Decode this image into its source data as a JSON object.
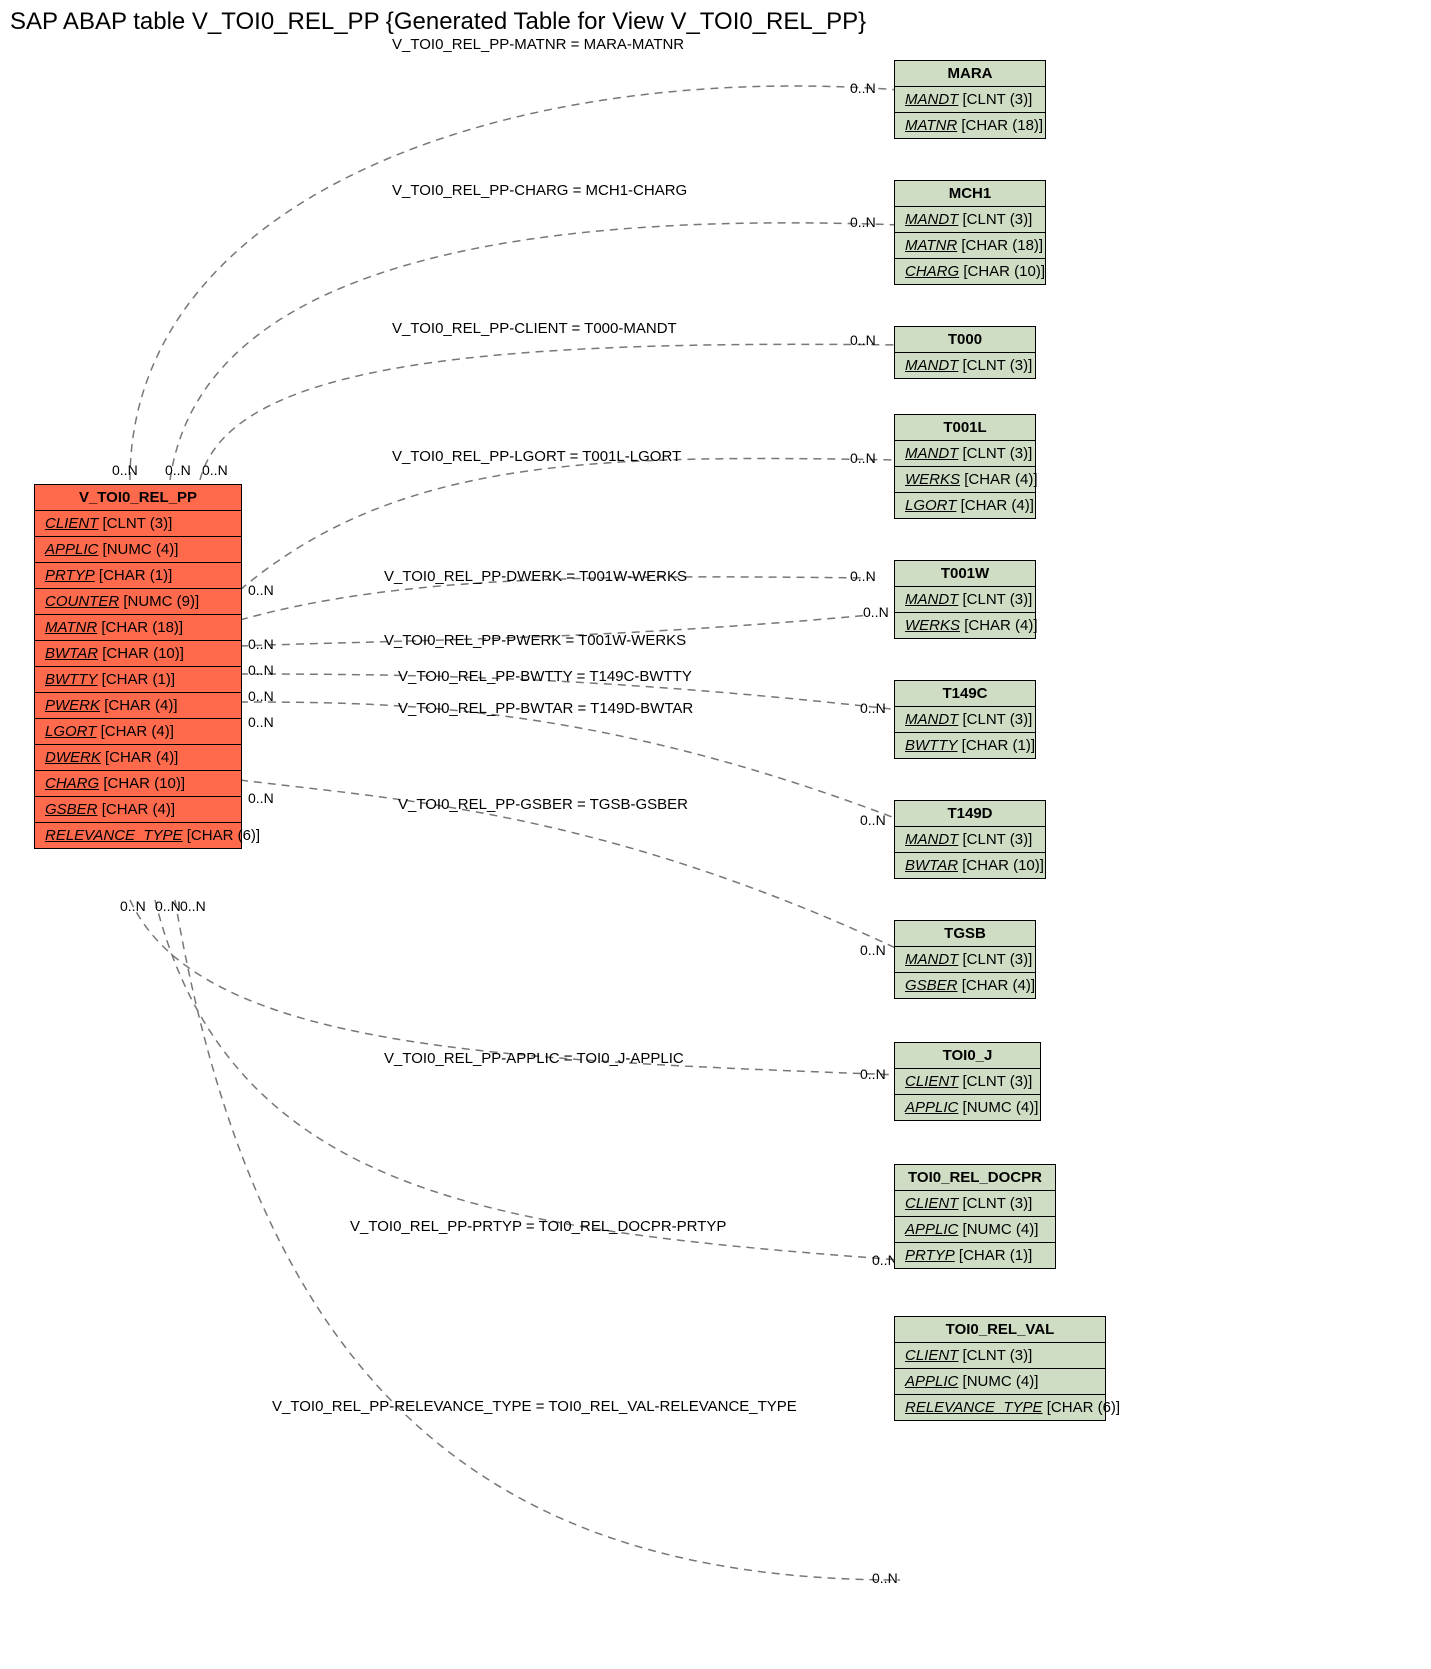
{
  "title": "SAP ABAP table V_TOI0_REL_PP {Generated Table for View V_TOI0_REL_PP}",
  "main_entity": {
    "name": "V_TOI0_REL_PP",
    "fields": [
      {
        "f": "CLIENT",
        "t": "[CLNT (3)]"
      },
      {
        "f": "APPLIC",
        "t": "[NUMC (4)]"
      },
      {
        "f": "PRTYP",
        "t": "[CHAR (1)]"
      },
      {
        "f": "COUNTER",
        "t": "[NUMC (9)]"
      },
      {
        "f": "MATNR",
        "t": "[CHAR (18)]"
      },
      {
        "f": "BWTAR",
        "t": "[CHAR (10)]"
      },
      {
        "f": "BWTTY",
        "t": "[CHAR (1)]"
      },
      {
        "f": "PWERK",
        "t": "[CHAR (4)]"
      },
      {
        "f": "LGORT",
        "t": "[CHAR (4)]"
      },
      {
        "f": "DWERK",
        "t": "[CHAR (4)]"
      },
      {
        "f": "CHARG",
        "t": "[CHAR (10)]"
      },
      {
        "f": "GSBER",
        "t": "[CHAR (4)]"
      },
      {
        "f": "RELEVANCE_TYPE",
        "t": "[CHAR (6)]"
      }
    ]
  },
  "entities": [
    {
      "name": "MARA",
      "fields": [
        {
          "f": "MANDT",
          "t": "[CLNT (3)]"
        },
        {
          "f": "MATNR",
          "t": "[CHAR (18)]"
        }
      ]
    },
    {
      "name": "MCH1",
      "fields": [
        {
          "f": "MANDT",
          "t": "[CLNT (3)]"
        },
        {
          "f": "MATNR",
          "t": "[CHAR (18)]"
        },
        {
          "f": "CHARG",
          "t": "[CHAR (10)]"
        }
      ]
    },
    {
      "name": "T000",
      "fields": [
        {
          "f": "MANDT",
          "t": "[CLNT (3)]"
        }
      ]
    },
    {
      "name": "T001L",
      "fields": [
        {
          "f": "MANDT",
          "t": "[CLNT (3)]"
        },
        {
          "f": "WERKS",
          "t": "[CHAR (4)]"
        },
        {
          "f": "LGORT",
          "t": "[CHAR (4)]"
        }
      ]
    },
    {
      "name": "T001W",
      "fields": [
        {
          "f": "MANDT",
          "t": "[CLNT (3)]"
        },
        {
          "f": "WERKS",
          "t": "[CHAR (4)]"
        }
      ]
    },
    {
      "name": "T149C",
      "fields": [
        {
          "f": "MANDT",
          "t": "[CLNT (3)]"
        },
        {
          "f": "BWTTY",
          "t": "[CHAR (1)]"
        }
      ]
    },
    {
      "name": "T149D",
      "fields": [
        {
          "f": "MANDT",
          "t": "[CLNT (3)]"
        },
        {
          "f": "BWTAR",
          "t": "[CHAR (10)]"
        }
      ]
    },
    {
      "name": "TGSB",
      "fields": [
        {
          "f": "MANDT",
          "t": "[CLNT (3)]"
        },
        {
          "f": "GSBER",
          "t": "[CHAR (4)]"
        }
      ]
    },
    {
      "name": "TOI0_J",
      "fields": [
        {
          "f": "CLIENT",
          "t": "[CLNT (3)]"
        },
        {
          "f": "APPLIC",
          "t": "[NUMC (4)]"
        }
      ]
    },
    {
      "name": "TOI0_REL_DOCPR",
      "fields": [
        {
          "f": "CLIENT",
          "t": "[CLNT (3)]"
        },
        {
          "f": "APPLIC",
          "t": "[NUMC (4)]"
        },
        {
          "f": "PRTYP",
          "t": "[CHAR (1)]"
        }
      ]
    },
    {
      "name": "TOI0_REL_VAL",
      "fields": [
        {
          "f": "CLIENT",
          "t": "[CLNT (3)]"
        },
        {
          "f": "APPLIC",
          "t": "[NUMC (4)]"
        },
        {
          "f": "RELEVANCE_TYPE",
          "t": "[CHAR (6)]"
        }
      ]
    }
  ],
  "relations": [
    {
      "label": "V_TOI0_REL_PP-MATNR = MARA-MATNR"
    },
    {
      "label": "V_TOI0_REL_PP-CHARG = MCH1-CHARG"
    },
    {
      "label": "V_TOI0_REL_PP-CLIENT = T000-MANDT"
    },
    {
      "label": "V_TOI0_REL_PP-LGORT = T001L-LGORT"
    },
    {
      "label": "V_TOI0_REL_PP-DWERK = T001W-WERKS"
    },
    {
      "label": "V_TOI0_REL_PP-PWERK = T001W-WERKS"
    },
    {
      "label": "V_TOI0_REL_PP-BWTTY = T149C-BWTTY"
    },
    {
      "label": "V_TOI0_REL_PP-BWTAR = T149D-BWTAR"
    },
    {
      "label": "V_TOI0_REL_PP-GSBER = TGSB-GSBER"
    },
    {
      "label": "V_TOI0_REL_PP-APPLIC = TOI0_J-APPLIC"
    },
    {
      "label": "V_TOI0_REL_PP-PRTYP = TOI0_REL_DOCPR-PRTYP"
    },
    {
      "label": "V_TOI0_REL_PP-RELEVANCE_TYPE = TOI0_REL_VAL-RELEVANCE_TYPE"
    }
  ],
  "card": "0..N",
  "left_cards_top": [
    "0..N",
    "0..N",
    "0..N"
  ],
  "left_cards_right": [
    "0..N",
    "0..N",
    "0..N",
    "0..N",
    "0..N",
    "0..N"
  ],
  "left_cards_bottom": [
    "0..N",
    "0..N",
    "0..N"
  ],
  "right_cards": [
    "0..N",
    "0..N",
    "0..N",
    "0..N",
    "0..N",
    "0..N",
    "0..N",
    "0..N",
    "0..N",
    "0..N",
    "0..N",
    "0..N"
  ]
}
